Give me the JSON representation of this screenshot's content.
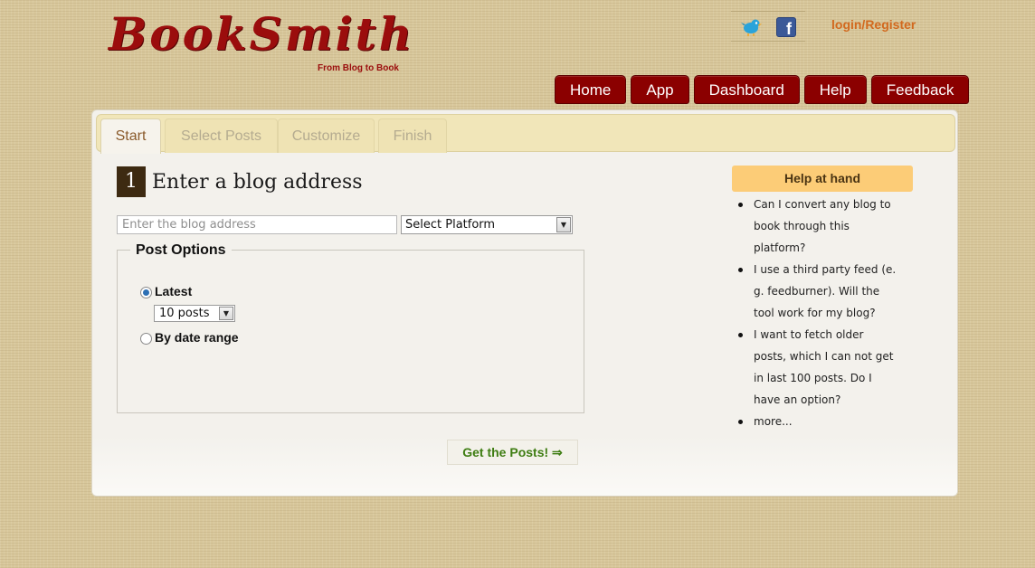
{
  "brand": {
    "title": "BookSmith",
    "tagline": "From Blog to Book"
  },
  "header": {
    "social_icons": [
      "twitter-icon",
      "facebook-icon"
    ],
    "login_label": "login/Register"
  },
  "nav": {
    "items": [
      {
        "label": "Home"
      },
      {
        "label": "App"
      },
      {
        "label": "Dashboard"
      },
      {
        "label": "Help"
      },
      {
        "label": "Feedback"
      }
    ]
  },
  "tabs": [
    {
      "label": "Start",
      "active": true
    },
    {
      "label": "Select Posts",
      "active": false
    },
    {
      "label": "Customize",
      "active": false
    },
    {
      "label": "Finish",
      "active": false
    }
  ],
  "step": {
    "number": "1",
    "title": "Enter a blog address"
  },
  "form": {
    "blog_placeholder": "Enter the blog address",
    "blog_value": "",
    "platform_selected": "Select Platform",
    "post_options_legend": "Post Options",
    "option_latest": "Latest",
    "latest_checked": true,
    "posts_count_selected": "10 posts",
    "option_date_range": "By date range",
    "date_range_checked": false,
    "submit_label": "Get the Posts! ⇒"
  },
  "help": {
    "header": "Help at hand",
    "items": [
      "Can I convert any blog to book through this platform?",
      "I use a third party feed (e. g. feedburner). Will the tool work for my blog?",
      "I want to fetch older posts, which I can not get in last 100 posts. Do I have an option?",
      "more..."
    ]
  },
  "colors": {
    "brand_red": "#8b0000",
    "accent_orange": "#d2691e",
    "help_header_bg": "#fccc77",
    "submit_green": "#3e7d12"
  }
}
